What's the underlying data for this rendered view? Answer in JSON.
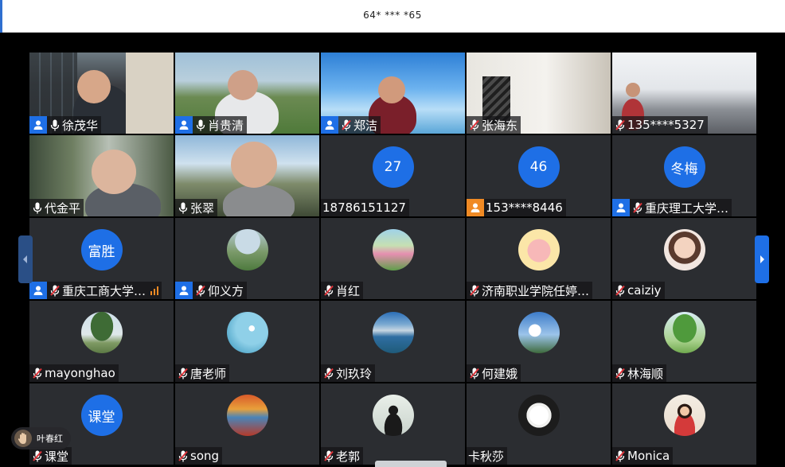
{
  "meeting": {
    "id_masked": "64* *** *65"
  },
  "participants": [
    {
      "name": "徐茂华",
      "badge": "user",
      "mic": "on",
      "video": "office",
      "active": true
    },
    {
      "name": "肖贵清",
      "badge": "user",
      "mic": "on",
      "video": "park"
    },
    {
      "name": "郑洁",
      "badge": "user",
      "mic": "muted",
      "video": "sky"
    },
    {
      "name": "张海东",
      "badge": "",
      "mic": "muted",
      "video": "room"
    },
    {
      "name": "135****5327",
      "badge": "",
      "mic": "muted",
      "video": "hall"
    },
    {
      "name": "代金平",
      "badge": "",
      "mic": "on",
      "video": "waterfall"
    },
    {
      "name": "张翠",
      "badge": "",
      "mic": "on",
      "video": "mountain"
    },
    {
      "name": "18786151127",
      "badge": "",
      "mic": "",
      "avatar_text": "27"
    },
    {
      "name": "153****8446",
      "badge": "user-orange",
      "mic": "",
      "avatar_text": "46"
    },
    {
      "name": "重庆理工大学…",
      "badge": "user",
      "mic": "muted",
      "avatar_text": "冬梅"
    },
    {
      "name": "重庆工商大学…",
      "badge": "user",
      "mic": "muted",
      "avatar_text": "富胜",
      "signal": true
    },
    {
      "name": "仰义方",
      "badge": "user",
      "mic": "muted",
      "avatar_img": "hill-cabin"
    },
    {
      "name": "肖红",
      "badge": "",
      "mic": "muted",
      "avatar_img": "flower-field"
    },
    {
      "name": "济南职业学院任婷…",
      "badge": "",
      "mic": "muted",
      "avatar_img": "pig-cartoon"
    },
    {
      "name": "caiziy",
      "badge": "",
      "mic": "muted",
      "avatar_img": "child"
    },
    {
      "name": "mayonghao",
      "badge": "",
      "mic": "muted",
      "avatar_img": "big-tree"
    },
    {
      "name": "唐老师",
      "badge": "",
      "mic": "muted",
      "avatar_img": "moon-sky"
    },
    {
      "name": "刘玖玲",
      "badge": "",
      "mic": "muted",
      "avatar_img": "lake-mountain"
    },
    {
      "name": "何建娥",
      "badge": "",
      "mic": "muted",
      "avatar_img": "cloud-sky"
    },
    {
      "name": "林海顺",
      "badge": "",
      "mic": "muted",
      "avatar_img": "green-tree"
    },
    {
      "name": "课堂",
      "badge": "",
      "mic": "muted",
      "avatar_text": "课堂"
    },
    {
      "name": "song",
      "badge": "",
      "mic": "muted",
      "avatar_img": "autumn-lake"
    },
    {
      "name": "老郭",
      "badge": "",
      "mic": "muted",
      "avatar_img": "silhouette"
    },
    {
      "name": "卡秋莎",
      "badge": "",
      "mic": "",
      "avatar_img": "magnolia"
    },
    {
      "name": "Monica",
      "badge": "",
      "mic": "muted",
      "avatar_img": "woman-red"
    }
  ],
  "raise_hand": {
    "name": "叶春红",
    "icon": "raised-hand-icon"
  },
  "colors": {
    "accent": "#1e6fe6",
    "muted_mic": "#e0353b",
    "active_mic": "#33c05a",
    "tile_bg": "#2b2d31"
  },
  "nav": {
    "prev_icon": "chevron-left-icon",
    "next_icon": "chevron-right-icon"
  }
}
